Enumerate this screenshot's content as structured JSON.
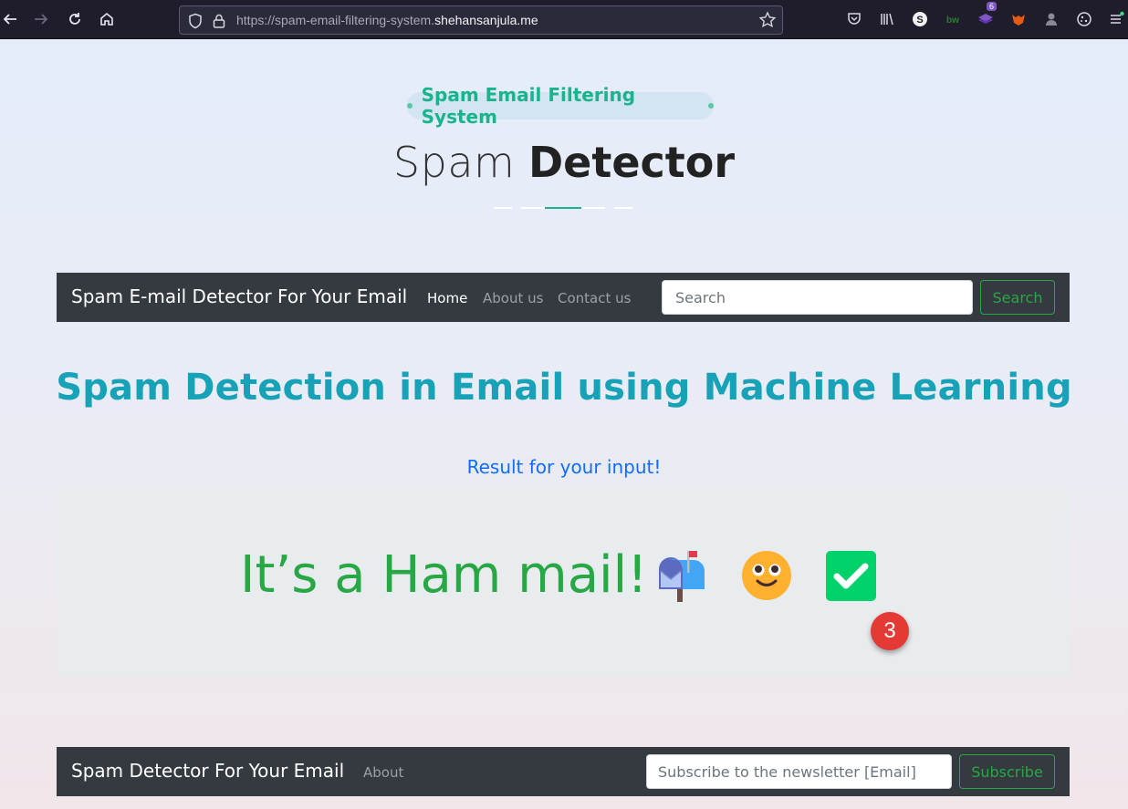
{
  "browser": {
    "url_prefix": "https://spam-email-filtering-system.",
    "url_domain": "shehansanjula.me",
    "notification_count": "6"
  },
  "header": {
    "kicker": "Spam Email Filtering System",
    "title_light": "Spam",
    "title_bold": "Detector"
  },
  "navbar": {
    "brand": "Spam E-mail Detector For Your Email",
    "links": [
      "Home",
      "About us",
      "Contact us"
    ],
    "search_placeholder": "Search",
    "search_button": "Search"
  },
  "main": {
    "title": "Spam Detection in Email using Machine Learning",
    "result_heading": "Result for your input!",
    "result_text": "It’s a Ham mail!",
    "badge_number": "3"
  },
  "footer": {
    "brand": "Spam Detector For Your Email",
    "link": "About",
    "subscribe_placeholder": "Subscribe to the newsletter [Email]",
    "subscribe_button": "Subscribe"
  },
  "colors": {
    "navbar_bg": "#343a40",
    "accent_green": "#28a745",
    "title_teal": "#17a2b8",
    "kicker_green": "#19b38c",
    "link_blue": "#0d6efd",
    "badge_red": "#e53935"
  }
}
